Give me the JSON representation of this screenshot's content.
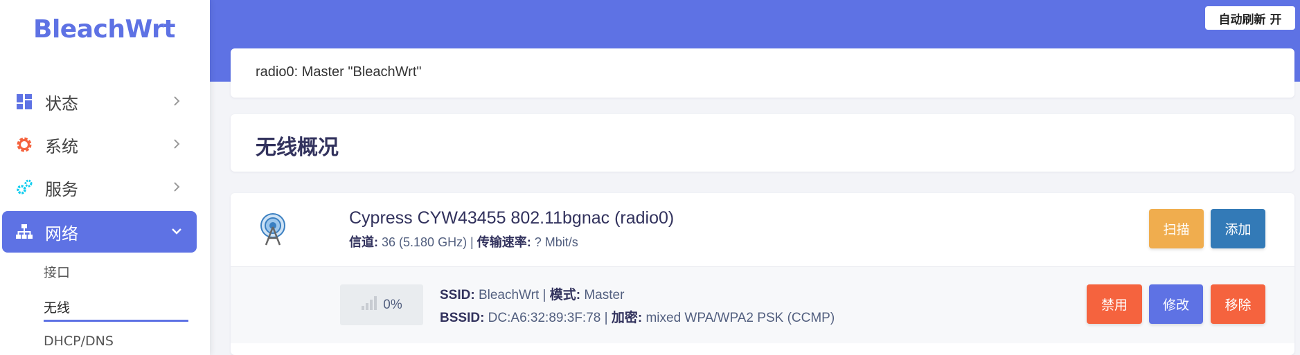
{
  "app": {
    "logo": "BleachWrt"
  },
  "header": {
    "auto_refresh": "自动刷新 开"
  },
  "sidebar": {
    "items": [
      {
        "label": "状态",
        "icon": "dashboard-icon"
      },
      {
        "label": "系统",
        "icon": "gear-icon"
      },
      {
        "label": "服务",
        "icon": "cogs-icon"
      },
      {
        "label": "网络",
        "icon": "network-icon"
      }
    ],
    "sub_items": [
      {
        "label": "接口"
      },
      {
        "label": "无线"
      },
      {
        "label": "DHCP/DNS"
      }
    ]
  },
  "notice": {
    "text": "radio0: Master \"BleachWrt\""
  },
  "section": {
    "title": "无线概况"
  },
  "device": {
    "name": "Cypress CYW43455 802.11bgnac (radio0)",
    "channel_label": "信道:",
    "channel_value": " 36 (5.180 GHz) | ",
    "rate_label": "传输速率:",
    "rate_value": " ? Mbit/s",
    "scan_button": "扫描",
    "add_button": "添加"
  },
  "network": {
    "signal_percent": "0%",
    "ssid_label": "SSID:",
    "ssid_value": " BleachWrt | ",
    "mode_label": "模式:",
    "mode_value": " Master",
    "bssid_label": "BSSID:",
    "bssid_value": " DC:A6:32:89:3F:78 | ",
    "enc_label": "加密:",
    "enc_value": " mixed WPA/WPA2 PSK (CCMP)",
    "disable_button": "禁用",
    "edit_button": "修改",
    "remove_button": "移除"
  },
  "colors": {
    "accent": "#5e72e4",
    "scan": "#f0ad4e",
    "add": "#337ab7",
    "danger": "#f5633e"
  }
}
